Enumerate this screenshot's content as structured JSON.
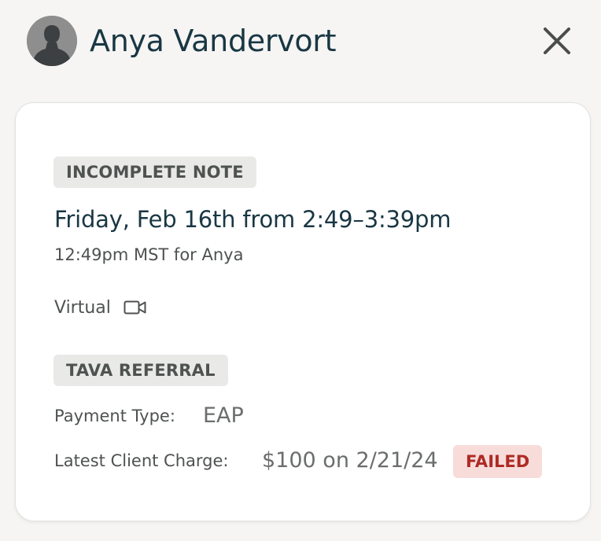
{
  "header": {
    "client_name": "Anya Vandervort",
    "avatar_icon": "person-silhouette-icon",
    "close_icon": "close-icon"
  },
  "appointment": {
    "note_status": "INCOMPLETE NOTE",
    "date_time": "Friday, Feb 16th from 2:49–3:39pm",
    "client_local_time": "12:49pm MST for Anya",
    "modality": "Virtual",
    "modality_icon": "video-camera-icon",
    "referral_badge": "TAVA REFERRAL",
    "payment": {
      "label": "Payment Type:",
      "value": "EAP"
    },
    "charge": {
      "label": "Latest Client Charge:",
      "value": "$100 on 2/21/24",
      "status": "FAILED"
    }
  },
  "colors": {
    "background": "#f6f5f3",
    "card": "#ffffff",
    "primary_text": "#193743",
    "secondary_text": "#4e5250",
    "badge_bg": "#e9e9e8",
    "failed_bg": "#f8dcda",
    "failed_text": "#ad2b25"
  }
}
